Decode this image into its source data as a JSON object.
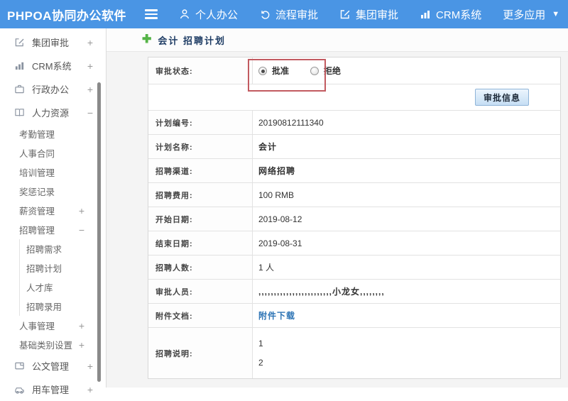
{
  "topbar": {
    "brand": "PHPOA协同办公软件",
    "nav": [
      {
        "label": "个人办公",
        "icon": "person-icon"
      },
      {
        "label": "流程审批",
        "icon": "history-icon"
      },
      {
        "label": "集团审批",
        "icon": "edit-icon"
      },
      {
        "label": "CRM系统",
        "icon": "bar-chart-icon"
      },
      {
        "label": "更多应用",
        "icon": "caret-down-icon"
      }
    ]
  },
  "sidebar": {
    "items": [
      {
        "label": "集团审批",
        "toggle": "+",
        "icon": "edit-icon"
      },
      {
        "label": "CRM系统",
        "toggle": "+",
        "icon": "bar-chart-icon"
      },
      {
        "label": "行政办公",
        "toggle": "+",
        "icon": "briefcase-icon"
      },
      {
        "label": "人力资源",
        "toggle": "−",
        "icon": "book-icon"
      },
      {
        "label": "考勤管理",
        "toggle": ""
      },
      {
        "label": "人事合同",
        "toggle": ""
      },
      {
        "label": "培训管理",
        "toggle": ""
      },
      {
        "label": "奖惩记录",
        "toggle": ""
      },
      {
        "label": "薪资管理",
        "toggle": "+"
      },
      {
        "label": "招聘管理",
        "toggle": "−"
      },
      {
        "label": "招聘需求",
        "toggle": ""
      },
      {
        "label": "招聘计划",
        "toggle": ""
      },
      {
        "label": "人才库",
        "toggle": ""
      },
      {
        "label": "招聘录用",
        "toggle": ""
      },
      {
        "label": "人事管理",
        "toggle": "+"
      },
      {
        "label": "基础类别设置",
        "toggle": "+"
      },
      {
        "label": "公文管理",
        "toggle": "+",
        "icon": "document-icon"
      },
      {
        "label": "用车管理",
        "toggle": "+",
        "icon": "car-icon"
      }
    ]
  },
  "main": {
    "title": "会计 招聘计划",
    "approval_status": {
      "label": "审批状态:",
      "options": [
        {
          "label": "批准",
          "selected": true
        },
        {
          "label": "拒绝",
          "selected": false
        }
      ]
    },
    "approve_button": "审批信息",
    "rows": [
      {
        "label": "计划编号:",
        "value": "20190812111340"
      },
      {
        "label": "计划名称:",
        "value": "会计"
      },
      {
        "label": "招聘渠道:",
        "value": "网络招聘"
      },
      {
        "label": "招聘费用:",
        "value": "100 RMB"
      },
      {
        "label": "开始日期:",
        "value": "2019-08-12"
      },
      {
        "label": "结束日期:",
        "value": "2019-08-31"
      },
      {
        "label": "招聘人数:",
        "value": "1 人"
      },
      {
        "label": "审批人员:",
        "value": ",,,,,,,,,,,,,,,,,,,,,,,,小龙女,,,,,,,,"
      },
      {
        "label": "附件文档:",
        "value": "附件下载"
      },
      {
        "label": "招聘说明:",
        "lines": [
          "1",
          "2"
        ]
      }
    ]
  },
  "colors": {
    "topbar_blue": "#4a95e4",
    "highlight_box_red": "#c25a60",
    "link_blue": "#2d74b5",
    "title_navy": "#1e3c64",
    "plus_green": "#54b347"
  }
}
